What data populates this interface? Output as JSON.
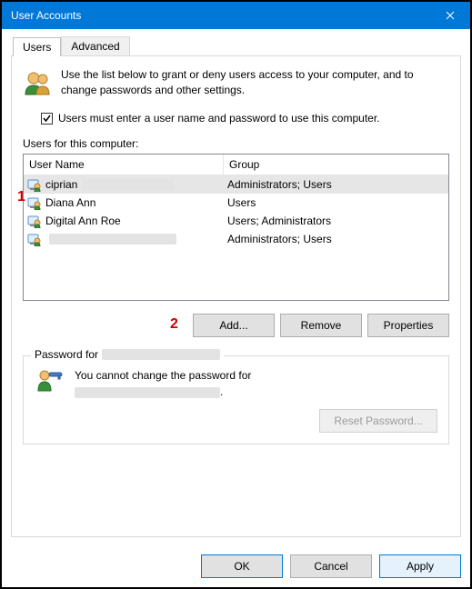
{
  "window": {
    "title": "User Accounts"
  },
  "tabs": {
    "users": "Users",
    "advanced": "Advanced"
  },
  "intro": "Use the list below to grant or deny users access to your computer, and to change passwords and other settings.",
  "checkbox": {
    "label": "Users must enter a user name and password to use this computer.",
    "checked": true
  },
  "annotations": {
    "a1": "1",
    "a2": "2"
  },
  "users_section": {
    "heading": "Users for this computer:",
    "columns": {
      "user": "User Name",
      "group": "Group"
    },
    "rows": [
      {
        "name": "ciprian",
        "redacted_after": true,
        "group": "Administrators; Users",
        "selected": true
      },
      {
        "name": "Diana Ann",
        "redacted_after": false,
        "group": "Users",
        "selected": false
      },
      {
        "name": "Digital Ann Roe",
        "redacted_after": false,
        "group": "Users; Administrators",
        "selected": false
      },
      {
        "name": "",
        "redacted_after": true,
        "group": "Administrators; Users",
        "selected": false
      }
    ]
  },
  "buttons": {
    "add": "Add...",
    "remove": "Remove",
    "properties": "Properties",
    "reset_pw": "Reset Password...",
    "ok": "OK",
    "cancel": "Cancel",
    "apply": "Apply"
  },
  "password_section": {
    "legend": "Password for",
    "message_prefix": "You cannot change the password for",
    "message_suffix": "."
  }
}
